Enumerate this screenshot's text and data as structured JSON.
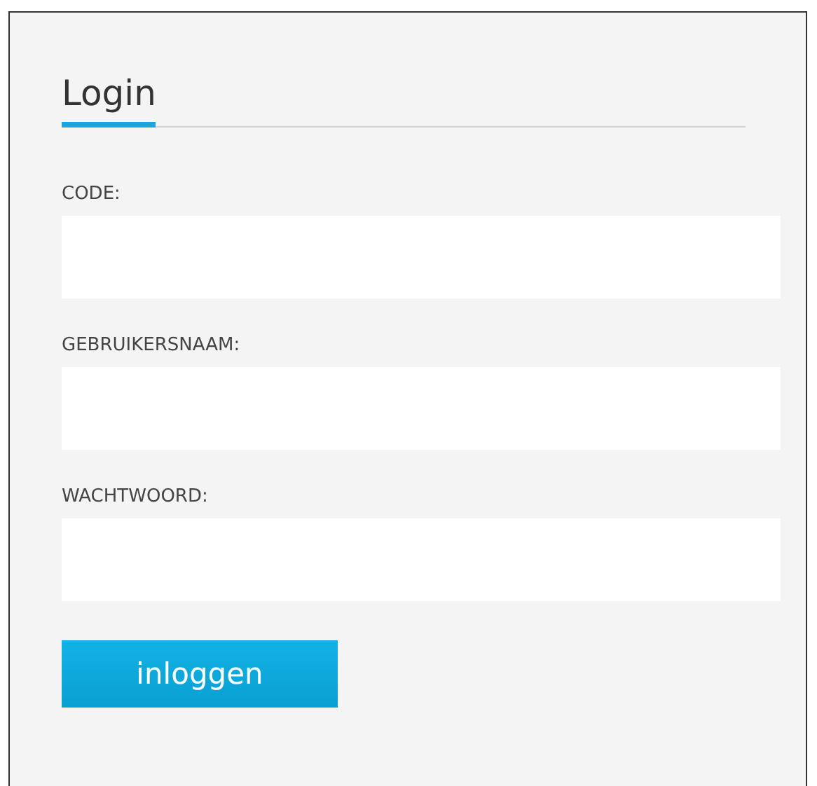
{
  "title": "Login",
  "fields": [
    {
      "label": "CODE:"
    },
    {
      "label": "GEBRUIKERSNAAM:"
    },
    {
      "label": "WACHTWOORD:"
    }
  ],
  "button": "inloggen"
}
